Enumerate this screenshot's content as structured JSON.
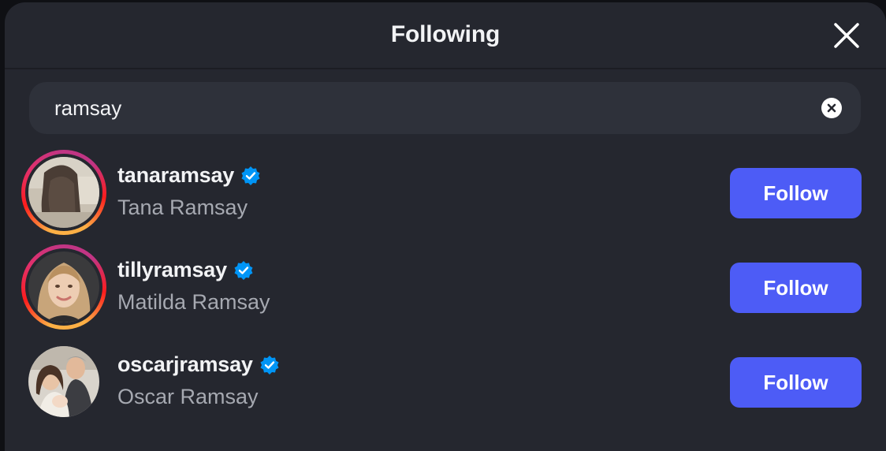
{
  "header": {
    "title": "Following"
  },
  "search": {
    "value": "ramsay"
  },
  "colors": {
    "accent": "#4d5cf6",
    "verified": "#0095f6",
    "background": "#25272f"
  },
  "users": [
    {
      "username": "tanaramsay",
      "full_name": "Tana Ramsay",
      "verified": true,
      "has_story_ring": true,
      "button_label": "Follow"
    },
    {
      "username": "tillyramsay",
      "full_name": "Matilda Ramsay",
      "verified": true,
      "has_story_ring": true,
      "button_label": "Follow"
    },
    {
      "username": "oscarjramsay",
      "full_name": "Oscar Ramsay",
      "verified": true,
      "has_story_ring": false,
      "button_label": "Follow"
    }
  ]
}
